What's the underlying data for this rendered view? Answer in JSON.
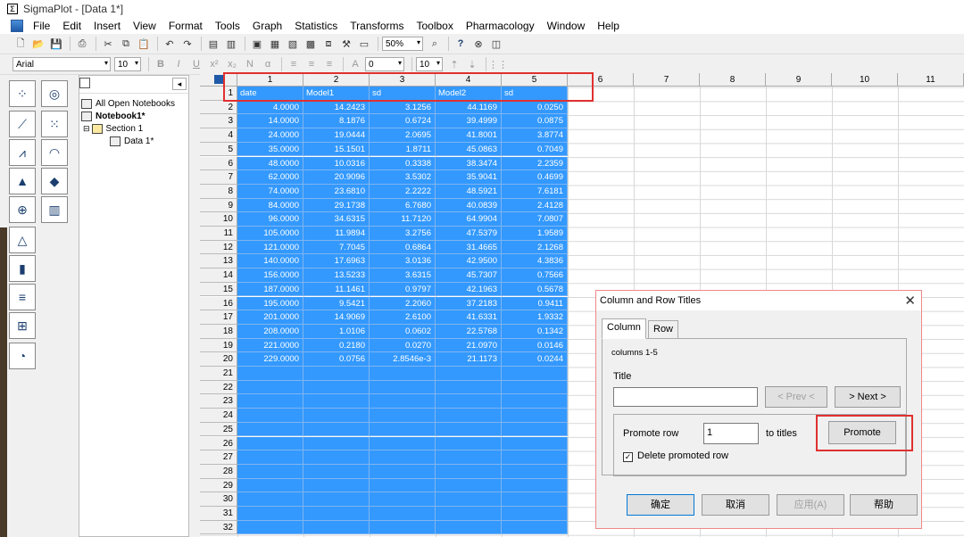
{
  "window": {
    "title": "SigmaPlot - [Data 1*]",
    "app_glyph": "Σ"
  },
  "menu": [
    "File",
    "Edit",
    "Insert",
    "View",
    "Format",
    "Tools",
    "Graph",
    "Statistics",
    "Transforms",
    "Toolbox",
    "Pharmacology",
    "Window",
    "Help"
  ],
  "toolbar1": {
    "zoom": "50%"
  },
  "toolbar2": {
    "font": "Arial",
    "size": "10",
    "indent": "0",
    "spacing": "10"
  },
  "tree": {
    "items": [
      "All Open Notebooks",
      "Notebook1*",
      "Section 1",
      "Data 1*"
    ]
  },
  "grid": {
    "col_headers": [
      "1",
      "2",
      "3",
      "4",
      "5",
      "6",
      "7",
      "8",
      "9",
      "10",
      "11"
    ],
    "row_headers": [
      "1",
      "2",
      "3",
      "4",
      "5",
      "6",
      "7",
      "8",
      "9",
      "10",
      "11",
      "12",
      "13",
      "14",
      "15",
      "16",
      "17",
      "18",
      "19",
      "20",
      "21",
      "22",
      "23",
      "24",
      "25",
      "26",
      "27",
      "28",
      "29",
      "30",
      "31",
      "32"
    ],
    "titles": [
      "date",
      "Model1",
      "sd",
      "Model2",
      "sd"
    ],
    "rows": [
      [
        "4.0000",
        "14.2423",
        "3.1256",
        "44.1169",
        "0.0250"
      ],
      [
        "14.0000",
        "8.1876",
        "0.6724",
        "39.4999",
        "0.0875"
      ],
      [
        "24.0000",
        "19.0444",
        "2.0695",
        "41.8001",
        "3.8774"
      ],
      [
        "35.0000",
        "15.1501",
        "1.8711",
        "45.0863",
        "0.7049"
      ],
      [
        "48.0000",
        "10.0316",
        "0.3338",
        "38.3474",
        "2.2359"
      ],
      [
        "62.0000",
        "20.9096",
        "3.5302",
        "35.9041",
        "0.4699"
      ],
      [
        "74.0000",
        "23.6810",
        "2.2222",
        "48.5921",
        "7.6181"
      ],
      [
        "84.0000",
        "29.1738",
        "6.7680",
        "40.0839",
        "2.4128"
      ],
      [
        "96.0000",
        "34.6315",
        "11.7120",
        "64.9904",
        "7.0807"
      ],
      [
        "105.0000",
        "11.9894",
        "3.2756",
        "47.5379",
        "1.9589"
      ],
      [
        "121.0000",
        "7.7045",
        "0.6864",
        "31.4665",
        "2.1268"
      ],
      [
        "140.0000",
        "17.6963",
        "3.0136",
        "42.9500",
        "4.3836"
      ],
      [
        "156.0000",
        "13.5233",
        "3.6315",
        "45.7307",
        "0.7566"
      ],
      [
        "187.0000",
        "11.1461",
        "0.9797",
        "42.1963",
        "0.5678"
      ],
      [
        "195.0000",
        "9.5421",
        "2.2060",
        "37.2183",
        "0.9411"
      ],
      [
        "201.0000",
        "14.9069",
        "2.6100",
        "41.6331",
        "1.9332"
      ],
      [
        "208.0000",
        "1.0106",
        "0.0602",
        "22.5768",
        "0.1342"
      ],
      [
        "221.0000",
        "0.2180",
        "0.0270",
        "21.0970",
        "0.0146"
      ],
      [
        "229.0000",
        "0.0756",
        "2.8546e-3",
        "21.1173",
        "0.0244"
      ]
    ]
  },
  "dialog": {
    "title": "Column and Row Titles",
    "tabs": [
      "Column",
      "Row"
    ],
    "range": "columns 1-5",
    "title_label": "Title",
    "title_value": "",
    "prev": "< Prev <",
    "next": "> Next >",
    "promote_row_label": "Promote row",
    "promote_row_value": "1",
    "to_titles": "to titles",
    "promote": "Promote",
    "delete_label": "Delete promoted row",
    "delete_checked": true,
    "ok": "确定",
    "cancel": "取消",
    "apply": "应用(A)",
    "help": "帮助"
  }
}
